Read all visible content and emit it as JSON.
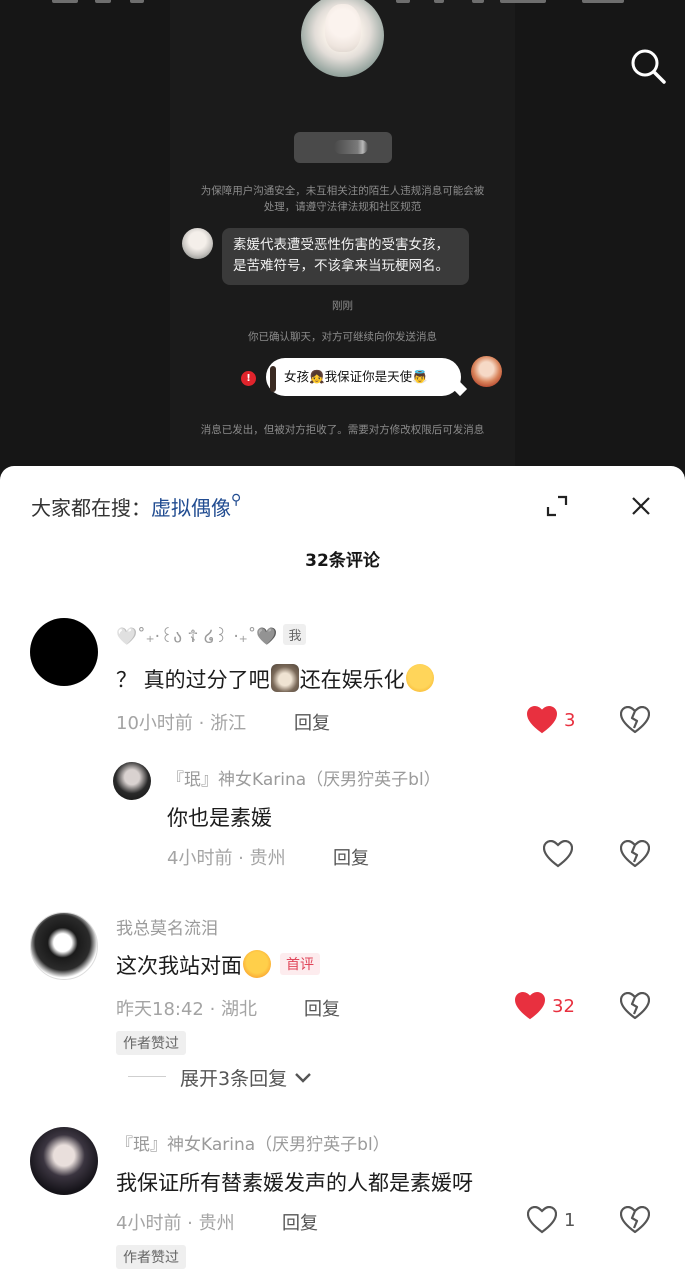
{
  "chat": {
    "notice_safety": "为保障用户沟通安全，未互相关注的陌生人违规消息可能会被处理，请遵守法律法规和社区规范",
    "message_text": "素媛代表遭受恶性伤害的受害女孩，是苦难符号，不该拿来当玩梗网名。",
    "time_label": "刚刚",
    "notice_confirm": "你已确认聊天，对方可继续向你发送消息",
    "sent_message": "女孩👧我保证你是天使👼",
    "notice_rejected": "消息已发出，但被对方拒收了。需要对方修改权限后可发消息"
  },
  "sheet": {
    "search_prefix": "大家都在搜：",
    "search_keyword": "虚拟偶像",
    "comment_count": "32条评论"
  },
  "comments": [
    {
      "username": "🤍˚₊‧꒰ა ☦ ໒꒱ ‧₊˚🩶",
      "me_tag": "我",
      "text_a": "？ 真的过分了吧",
      "text_b": "还在娱乐化",
      "time": "10小时前 · 浙江",
      "reply": "回复",
      "likes": "3",
      "liked": true
    },
    {
      "username": "『珉』神女Karina（厌男狞英子bl）",
      "text": "你也是素媛",
      "time": "4小时前 · 贵州",
      "reply": "回复",
      "likes": "",
      "liked": false
    },
    {
      "username": "我总莫名流泪",
      "text": "这次我站对面",
      "first_tag": "首评",
      "time": "昨天18:42 · 湖北",
      "reply": "回复",
      "likes": "32",
      "liked": true,
      "badge": "作者赞过",
      "expand": "展开3条回复"
    },
    {
      "username": "『珉』神女Karina（厌男狞英子bl）",
      "text": "我保证所有替素媛发声的人都是素媛呀",
      "time": "4小时前 · 贵州",
      "reply": "回复",
      "likes": "1",
      "liked": false,
      "badge": "作者赞过"
    }
  ],
  "colors": {
    "like_red": "#e8303f",
    "keyword_blue": "#214c91",
    "chat_bg": "#161616"
  },
  "icons": [
    "search-icon",
    "expand-icon",
    "close-icon",
    "heart-icon",
    "broken-heart-icon",
    "chevron-down-icon",
    "error-icon"
  ]
}
